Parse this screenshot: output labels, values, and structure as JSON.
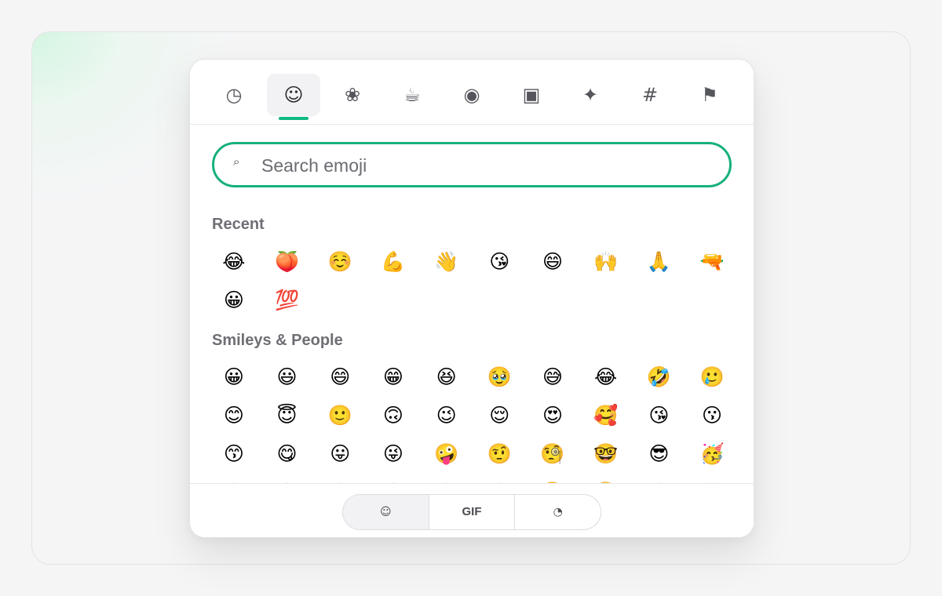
{
  "categories": [
    {
      "icon": "recent-clock-icon",
      "glyph": "◷",
      "active": false
    },
    {
      "icon": "smiley-icon",
      "glyph": "☺",
      "active": true
    },
    {
      "icon": "flower-icon",
      "glyph": "❀",
      "active": false
    },
    {
      "icon": "coffee-icon",
      "glyph": "☕",
      "active": false
    },
    {
      "icon": "activity-circle-icon",
      "glyph": "◉",
      "active": false
    },
    {
      "icon": "objects-square-icon",
      "glyph": "▣",
      "active": false
    },
    {
      "icon": "sparkle-icon",
      "glyph": "✦",
      "active": false
    },
    {
      "icon": "symbols-hash-icon",
      "glyph": "#",
      "active": false
    },
    {
      "icon": "flag-icon",
      "glyph": "⚑",
      "active": false
    }
  ],
  "search": {
    "placeholder": "Search emoji",
    "value": "",
    "icon": "search-icon",
    "glyph": "⌕"
  },
  "sections": {
    "recent": {
      "title": "Recent",
      "emojis": [
        "😂",
        "🍑",
        "☺️",
        "💪",
        "👋",
        "😘",
        "😄",
        "🙌",
        "🙏",
        "🔫",
        "😀",
        "💯"
      ]
    },
    "smileys": {
      "title": "Smileys & People",
      "emojis": [
        "😀",
        "😃",
        "😄",
        "😁",
        "😆",
        "🥹",
        "😅",
        "😂",
        "🤣",
        "🥲",
        "😊",
        "😇",
        "🙂",
        "🙃",
        "😉",
        "😌",
        "😍",
        "🥰",
        "😘",
        "😗",
        "😙",
        "😋",
        "😛",
        "😜",
        "🤪",
        "🤨",
        "🧐",
        "🤓",
        "😎",
        "🥳",
        "😏",
        "😒",
        "😞",
        "😔",
        "😟",
        "😕",
        "🙁",
        "☹️",
        "😣",
        "😖"
      ]
    }
  },
  "footer": {
    "tabs": [
      {
        "name": "emoji-tab",
        "label": "☺",
        "active": true
      },
      {
        "name": "gif-tab",
        "label": "GIF",
        "active": false
      },
      {
        "name": "recent-tab",
        "label": "◔",
        "active": false
      }
    ]
  },
  "colors": {
    "accent": "#10b981",
    "search_border": "#16b07e"
  }
}
